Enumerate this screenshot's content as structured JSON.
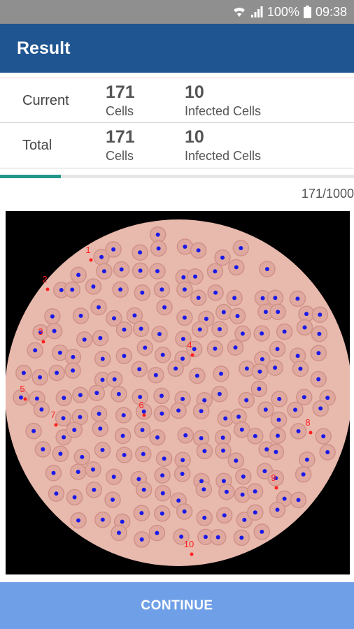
{
  "status_bar": {
    "battery": "100%",
    "time": "09:38",
    "icons": [
      "wifi-icon",
      "signal-icon",
      "battery-icon"
    ]
  },
  "app_bar": {
    "title": "Result"
  },
  "stats": {
    "current": {
      "label": "Current",
      "cells": "171",
      "cells_caption": "Cells",
      "infected": "10",
      "infected_caption": "Infected Cells"
    },
    "total": {
      "label": "Total",
      "cells": "171",
      "cells_caption": "Cells",
      "infected": "10",
      "infected_caption": "Infected Cells"
    }
  },
  "progress": {
    "text": "171/1000",
    "fraction": 0.171
  },
  "image": {
    "infected_markers": [
      "1",
      "2",
      "3",
      "4",
      "5",
      "6",
      "7",
      "8",
      "9",
      "10"
    ]
  },
  "footer": {
    "continue_label": "CONTINUE"
  },
  "colors": {
    "app_bar": "#1f5590",
    "progress": "#23968a",
    "button": "#6f9fe6",
    "cell_dot": "#1a1ae8",
    "infected_marker": "#ff2020"
  }
}
